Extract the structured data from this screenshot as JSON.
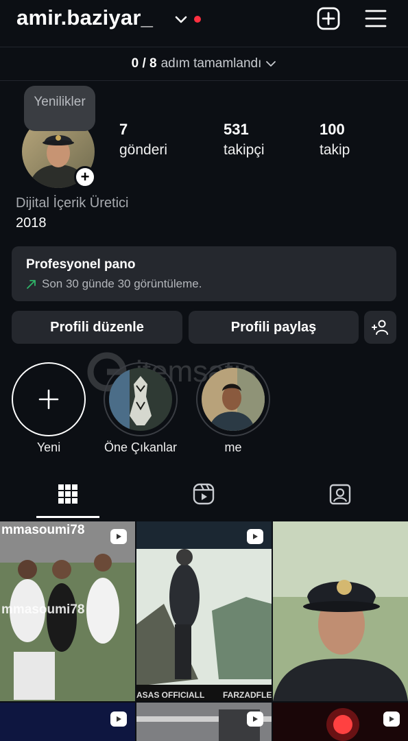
{
  "header": {
    "username": "amir.baziyar_",
    "icons": [
      "chevron-down-icon",
      "notification-dot",
      "add-square-icon",
      "menu-icon"
    ]
  },
  "steps": {
    "progress": "0 / 8",
    "label": "adım tamamlandı"
  },
  "profile": {
    "tooltip": "Yenilikler",
    "stats": [
      {
        "value": "7",
        "label": "gönderi"
      },
      {
        "value": "531",
        "label": "takipçi"
      },
      {
        "value": "100",
        "label": "takip"
      }
    ],
    "category": "Dijital İçerik Üretici",
    "bio": "2018"
  },
  "pro_dashboard": {
    "title": "Profesyonel pano",
    "subtitle": "Son 30 günde 30 görüntüleme."
  },
  "actions": {
    "edit_profile": "Profili düzenle",
    "share_profile": "Profili paylaş"
  },
  "highlights": [
    {
      "label": "Yeni"
    },
    {
      "label": "Öne Çıkanlar"
    },
    {
      "label": "me"
    }
  ],
  "grid": {
    "thumb_texts": [
      "mmasoumi78",
      "mmasoumi78",
      "ASAS OFFICIALL",
      "FARZADFLE"
    ]
  },
  "colors": {
    "background": "#0c0f14",
    "card": "#25282e",
    "notification": "#ff3040",
    "trend": "#2fb568"
  }
}
